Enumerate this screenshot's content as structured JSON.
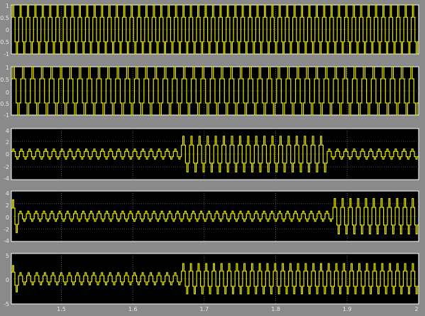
{
  "chart_data": [
    {
      "type": "line",
      "ylim": [
        -1,
        1
      ],
      "y_ticks": [
        "1",
        "0.5",
        "0",
        "-0.5",
        "-1"
      ],
      "x_range": [
        1.43,
        2.0
      ],
      "x_ticks": [
        "1.5",
        "1.6",
        "1.7",
        "1.8",
        "1.9",
        "2"
      ],
      "grid": true,
      "line_color": "#e6e600",
      "background": "#000000",
      "signal": "quasi-square wave (stepped) with ~6 steps per period, amplitude 1, about 55 cycles across the window",
      "segments": [
        {
          "x_start": 1.43,
          "x_end": 2.0,
          "amplitude": 1,
          "cycles": 55
        }
      ]
    },
    {
      "type": "line",
      "ylim": [
        -1,
        1
      ],
      "y_ticks": [
        "1",
        "0.5",
        "0",
        "-0.5",
        "-1"
      ],
      "x_range": [
        1.43,
        2.0
      ],
      "x_ticks": [
        "1.5",
        "1.6",
        "1.7",
        "1.8",
        "1.9",
        "2"
      ],
      "grid": true,
      "line_color": "#e6e600",
      "background": "#000000",
      "signal": "quasi-square wave (stepped) with ~6 steps per period, amplitude 1, about 43 cycles across the window",
      "segments": [
        {
          "x_start": 1.43,
          "x_end": 2.0,
          "amplitude": 1,
          "cycles": 43
        }
      ]
    },
    {
      "type": "line",
      "ylim": [
        -4,
        4
      ],
      "y_ticks": [
        "4",
        "2",
        "0",
        "-2",
        "-4"
      ],
      "x_range": [
        1.43,
        2.0
      ],
      "x_ticks": [
        "1.5",
        "1.6",
        "1.7",
        "1.8",
        "1.9",
        "2"
      ],
      "grid": true,
      "line_color": "#e6e600",
      "background": "#000000",
      "segments": [
        {
          "x_start": 1.43,
          "x_end": 1.668,
          "amplitude": 0.8,
          "cycles": 21
        },
        {
          "x_start": 1.668,
          "x_end": 1.872,
          "amplitude": 2.8,
          "cycles": 18
        },
        {
          "x_start": 1.872,
          "x_end": 2.0,
          "amplitude": 0.8,
          "cycles": 11
        }
      ]
    },
    {
      "type": "line",
      "ylim": [
        -4,
        4
      ],
      "y_ticks": [
        "4",
        "2",
        "0",
        "-2",
        "-4"
      ],
      "x_range": [
        1.43,
        2.0
      ],
      "x_ticks": [
        "1.5",
        "1.6",
        "1.7",
        "1.8",
        "1.9",
        "2"
      ],
      "grid": true,
      "line_color": "#e6e600",
      "background": "#000000",
      "segments": [
        {
          "x_start": 1.43,
          "x_end": 1.44,
          "amplitude": 2.6,
          "cycles": 1
        },
        {
          "x_start": 1.44,
          "x_end": 1.88,
          "amplitude": 0.8,
          "cycles": 40
        },
        {
          "x_start": 1.88,
          "x_end": 2.0,
          "amplitude": 2.8,
          "cycles": 11
        }
      ]
    },
    {
      "type": "line",
      "ylim": [
        -5,
        5
      ],
      "y_ticks": [
        "5",
        "0",
        "-5"
      ],
      "x_range": [
        1.43,
        2.0
      ],
      "x_ticks": [
        "1.5",
        "1.6",
        "1.7",
        "1.8",
        "1.9",
        "2"
      ],
      "grid": true,
      "line_color": "#e6e600",
      "background": "#000000",
      "segments": [
        {
          "x_start": 1.43,
          "x_end": 1.44,
          "amplitude": 2.6,
          "cycles": 1
        },
        {
          "x_start": 1.44,
          "x_end": 1.668,
          "amplitude": 1.2,
          "cycles": 20
        },
        {
          "x_start": 1.668,
          "x_end": 2.0,
          "amplitude": 3.0,
          "cycles": 31
        }
      ]
    }
  ]
}
